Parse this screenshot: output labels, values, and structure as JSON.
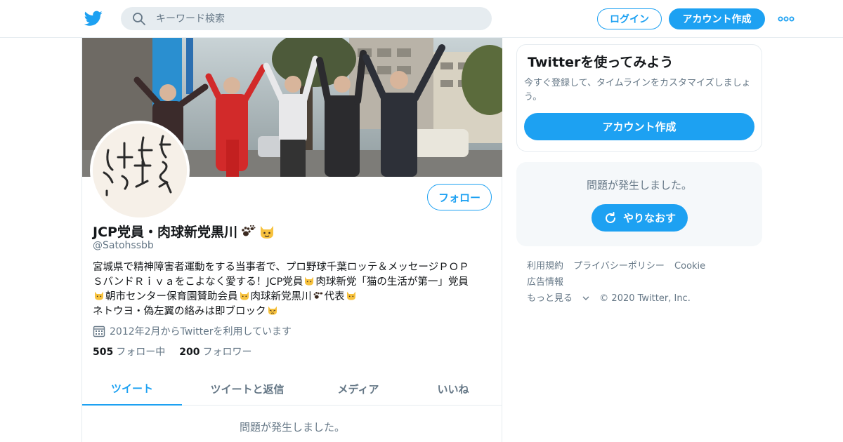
{
  "header": {
    "logo_icon": "twitter-bird-icon",
    "search_placeholder": "キーワード検索",
    "login_label": "ログイン",
    "signup_label": "アカウント作成",
    "more_icon": "more-dots-icon"
  },
  "profile": {
    "name": "JCP党員・肉球新党黒川",
    "name_emojis": [
      "paw-prints-icon",
      "cat-face-icon"
    ],
    "handle": "@Satohssbb",
    "follow_label": "フォロー",
    "bio": {
      "line1": "宮城県で精神障害者運動をする当事者で、プロ野球千葉ロッテ＆メッセージＰＯＰ",
      "line2_a": "ＳバンドＲｉｖａをこよなく愛する！JCP党員",
      "line2_b": "肉球新党「猫の生活が第一」党員",
      "line3_a": "朝市センター保育園賛助会員",
      "line3_b": "肉球新党黒川",
      "line3_c": "代表",
      "line4": "ネトウヨ・偽左翼の絡みは即ブロック"
    },
    "joined": "2012年2月からTwitterを利用しています",
    "following_count": "505",
    "following_label": "フォロー中",
    "followers_count": "200",
    "followers_label": "フォロワー",
    "avatar_text": "ぼくは戦争はきらい！"
  },
  "tabs": [
    {
      "label": "ツイート",
      "active": true
    },
    {
      "label": "ツイートと返信",
      "active": false
    },
    {
      "label": "メディア",
      "active": false
    },
    {
      "label": "いいね",
      "active": false
    }
  ],
  "main_error": "問題が発生しました。",
  "sidebar": {
    "signup_card": {
      "title": "Twitterを使ってみよう",
      "text": "今すぐ登録して、タイムラインをカスタマイズしましょう。",
      "button": "アカウント作成"
    },
    "error_card": {
      "text": "問題が発生しました。",
      "retry_label": "やりなおす"
    },
    "footer": {
      "terms": "利用規約",
      "privacy": "プライバシーポリシー",
      "cookie": "Cookie",
      "ads": "広告情報",
      "more": "もっと見る",
      "copyright": "© 2020 Twitter, Inc."
    }
  },
  "colors": {
    "accent": "#1da1f2",
    "secondary_text": "#657786",
    "border": "#e6ecf0"
  }
}
